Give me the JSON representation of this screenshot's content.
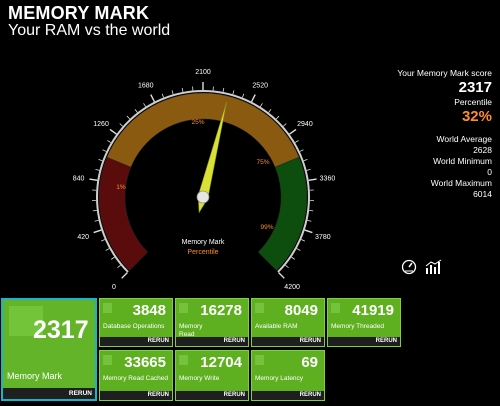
{
  "header": {
    "title": "MEMORY MARK",
    "subtitle": "Your RAM vs the world"
  },
  "gauge": {
    "ticks": [
      "0",
      "420",
      "840",
      "1260",
      "1680",
      "2100",
      "2520",
      "2940",
      "3360",
      "3780",
      "4200"
    ],
    "percentile_marks": [
      "1%",
      "25%",
      "75%",
      "99%"
    ],
    "center_title": "Memory Mark",
    "center_subtitle": "Percentile",
    "value": 2317,
    "max": 4200,
    "colors": {
      "low": "#5a0c0c",
      "mid": "#8a5a10",
      "high": "#0d4d0d",
      "needle": "#d9e234"
    }
  },
  "stats": {
    "score_label": "Your Memory Mark score",
    "score": "2317",
    "percentile_label": "Percentile",
    "percentile": "32%",
    "avg_label": "World Average",
    "avg": "2628",
    "min_label": "World Minimum",
    "min": "0",
    "max_label": "World Maximum",
    "max": "6014"
  },
  "icons": {
    "gauge_icon": "speedometer-icon",
    "chart_icon": "bar-chart-icon"
  },
  "tiles": {
    "main": {
      "value": "2317",
      "label": "Memory Mark",
      "rerun": "RERUN"
    },
    "items": [
      {
        "value": "3848",
        "label": "Database Operations",
        "rerun": "RERUN"
      },
      {
        "value": "16278",
        "label": "Memory Read Uncached",
        "rerun": "RERUN"
      },
      {
        "value": "8049",
        "label": "Available RAM",
        "rerun": "RERUN"
      },
      {
        "value": "41919",
        "label": "Memory Threaded",
        "rerun": "RERUN"
      },
      {
        "value": "33665",
        "label": "Memory Read Cached",
        "rerun": "RERUN"
      },
      {
        "value": "12704",
        "label": "Memory Write",
        "rerun": "RERUN"
      },
      {
        "value": "69",
        "label": "Memory Latency",
        "rerun": "RERUN"
      }
    ]
  }
}
